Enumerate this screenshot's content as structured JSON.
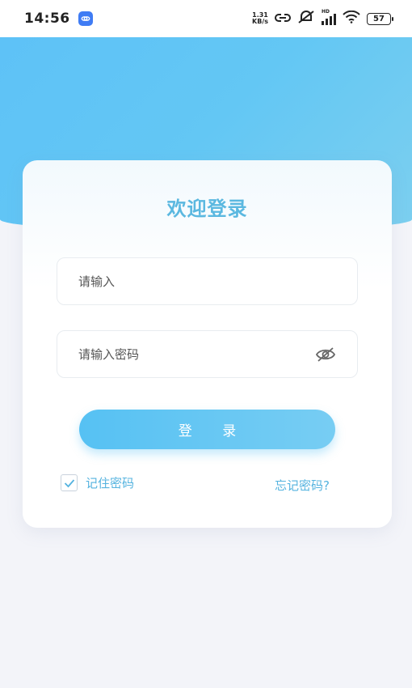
{
  "status_bar": {
    "time": "14:56",
    "net_speed_value": "1.31",
    "net_speed_unit": "KB/s",
    "battery": "57",
    "signal_hd": "HD"
  },
  "login": {
    "title": "欢迎登录",
    "username_placeholder": "请输入",
    "password_placeholder": "请输入密码",
    "login_button": "登 录",
    "remember_label": "记住密码",
    "remember_checked": true,
    "forgot_link": "忘记密码?"
  },
  "colors": {
    "accent": "#5bb8e0",
    "hero_gradient_start": "#5ec2f7",
    "hero_gradient_end": "#7ccfef",
    "background": "#f3f4f9"
  },
  "icons": {
    "app_badge": "link-icon",
    "eye_toggle": "eye-off-icon"
  }
}
